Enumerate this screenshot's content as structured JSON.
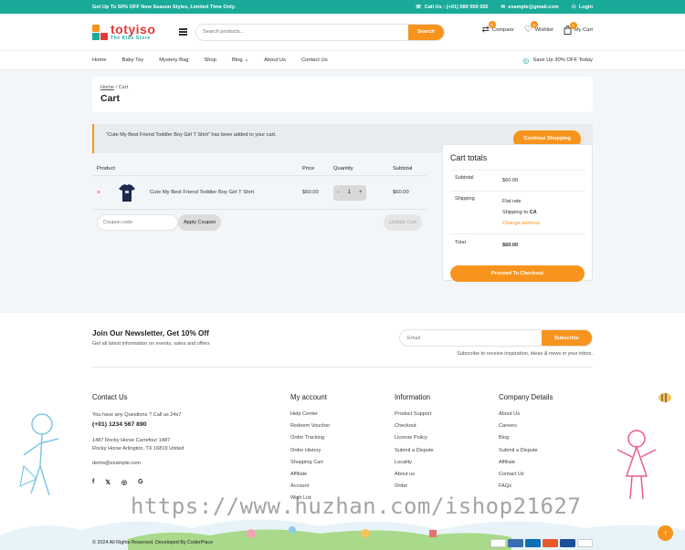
{
  "topbar": {
    "promo": "Get Up To 50% OFF New Season Styles, Limited Time Only.",
    "call": "Call Us : (+01) 589 559 555",
    "email": "example@gmail.com",
    "login": "Login"
  },
  "logo": {
    "name": "totyiso",
    "tagline": "The Kids Store"
  },
  "search": {
    "placeholder": "Search products...",
    "button": "Search"
  },
  "header": {
    "compare": "Compare",
    "compare_count": "0",
    "wishlist": "Wishlist",
    "wishlist_count": "0",
    "cart": "My Cart",
    "cart_count": "1"
  },
  "nav": {
    "items": [
      "Home",
      "Baby Toy",
      "Mystery Bag",
      "Shop",
      "Blog",
      "About Us",
      "Contact Us"
    ],
    "promo": "Save Up 30% OFF Today"
  },
  "breadcrumb": {
    "home": "Home",
    "sep": " / ",
    "current": "Cart"
  },
  "page_title": "Cart",
  "notice": {
    "text": "“Cute My Best Friend Toddler Boy Girl T Shirt” has been added to your cart.",
    "button": "Continue Shopping"
  },
  "cart": {
    "headers": {
      "product": "Product",
      "price": "Price",
      "quantity": "Quantity",
      "subtotal": "Subtotal"
    },
    "items": [
      {
        "remove": "×",
        "name": "Cute My Best Friend Toddler Boy Girl T Shirt",
        "price": "$60.00",
        "qty": "1",
        "subtotal": "$60.00"
      }
    ],
    "coupon_placeholder": "Coupon code",
    "apply": "Apply Coupon",
    "update": "Update Cart"
  },
  "totals": {
    "title": "Cart totals",
    "subtotal_label": "Subtotal",
    "subtotal": "$60.00",
    "shipping_label": "Shipping",
    "shipping_method": "Flat rate",
    "shipping_to": "Shipping to",
    "shipping_country": "CA",
    "change_address": "Change address",
    "total_label": "Total",
    "total": "$60.00",
    "checkout": "Proceed To Checkout"
  },
  "newsletter": {
    "title": "Join Our Newsletter, Get 10% Off",
    "subtitle": "Get all latest information on events, sales and offers",
    "placeholder": "Email",
    "button": "Subscribe",
    "note": "Subscribe to receive inspiration, ideas & news in your inbox."
  },
  "footer": {
    "contact": {
      "title": "Contact Us",
      "question": "You have any Questions ? Call us 24x7",
      "phone": "(+01) 1234 567 890",
      "addr1": "1487 Rocky Horse Carrefour 1487",
      "addr2": "Rocky Horse Arlington, TX 16819 United",
      "email": "demo@example.com"
    },
    "account": {
      "title": "My account",
      "links": [
        "Help Center",
        "Redeem Voucher",
        "Order Tracking",
        "Order History",
        "Shopping Cart",
        "Affiliate",
        "Account",
        "Wish List"
      ]
    },
    "information": {
      "title": "Information",
      "links": [
        "Product Support",
        "Checkout",
        "License Policy",
        "Submit a Dispute",
        "Locality",
        "About us",
        "Order"
      ]
    },
    "company": {
      "title": "Company Details",
      "links": [
        "About Us",
        "Careers",
        "Blog",
        "Submit a Dispute",
        "Affiliate",
        "Contact Us",
        "FAQs"
      ]
    },
    "copyright": "© 2024 All Rights Reserved. Developed By CoderPlace"
  },
  "watermark": "https://www.huzhan.com/ishop21627",
  "colors": {
    "teal": "#1aaa9a",
    "orange": "#f7941d",
    "red": "#e53935"
  }
}
